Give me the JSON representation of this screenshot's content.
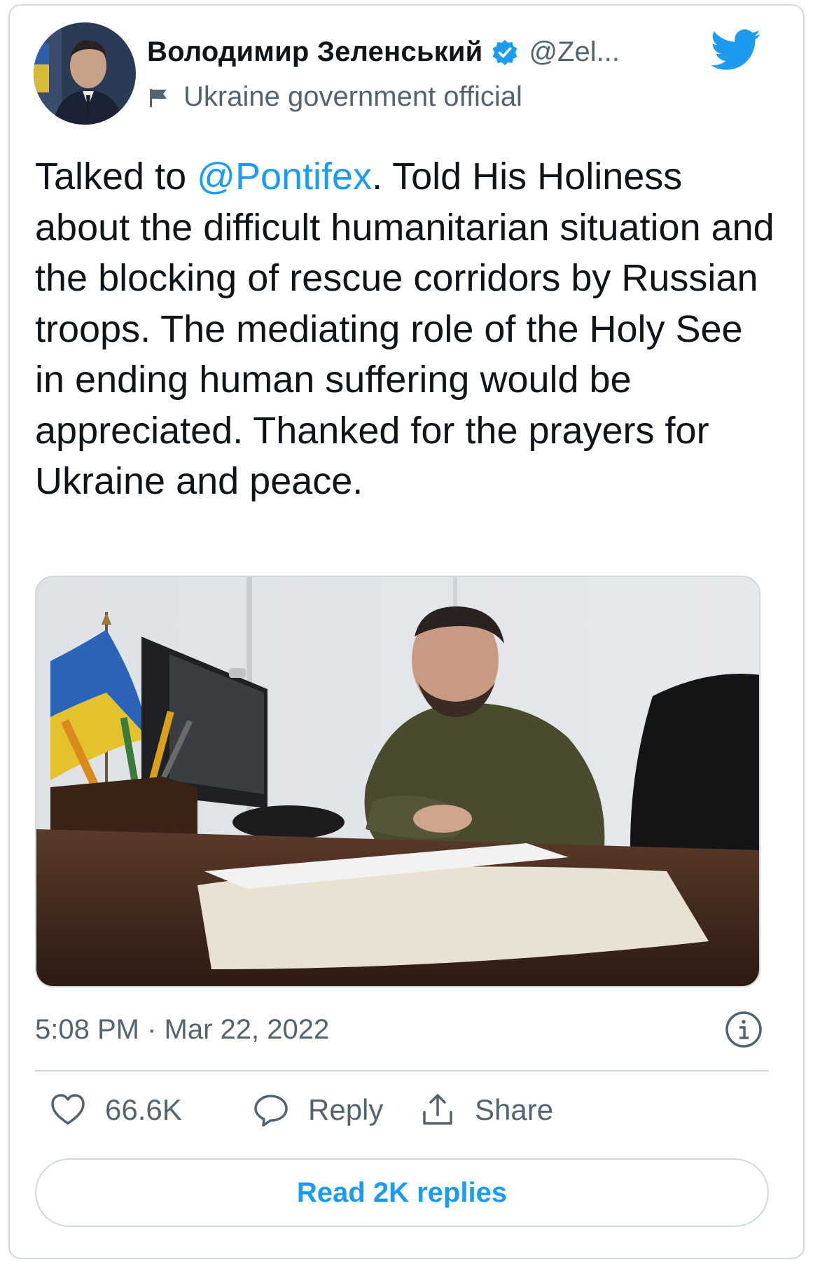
{
  "author": {
    "display_name": "Володимир Зеленський",
    "handle": "@Zel...",
    "label": "Ukraine government official"
  },
  "tweet": {
    "text_before": "Talked to ",
    "mention": "@Pontifex",
    "text_after": ". Told His Holiness about the difficult humanitarian situation and the blocking of rescue corridors by Russian troops. The mediating role of the Holy See in ending human suffering would be appreciated. Thanked for the prayers for Ukraine and peace.",
    "timestamp": "5:08 PM · Mar 22, 2022"
  },
  "actions": {
    "like_count": "66.6K",
    "reply_label": "Reply",
    "share_label": "Share"
  },
  "read_replies_label": "Read 2K replies",
  "icons": {
    "verified": "verified-badge-icon",
    "twitter": "twitter-bird-icon",
    "label_flag": "flag-icon",
    "info": "info-icon",
    "like": "heart-icon",
    "reply": "speech-bubble-icon",
    "share": "share-icon"
  },
  "colors": {
    "accent": "#1d9bf0",
    "text": "#0f1419",
    "secondary": "#536471",
    "border": "#cfd9de"
  }
}
